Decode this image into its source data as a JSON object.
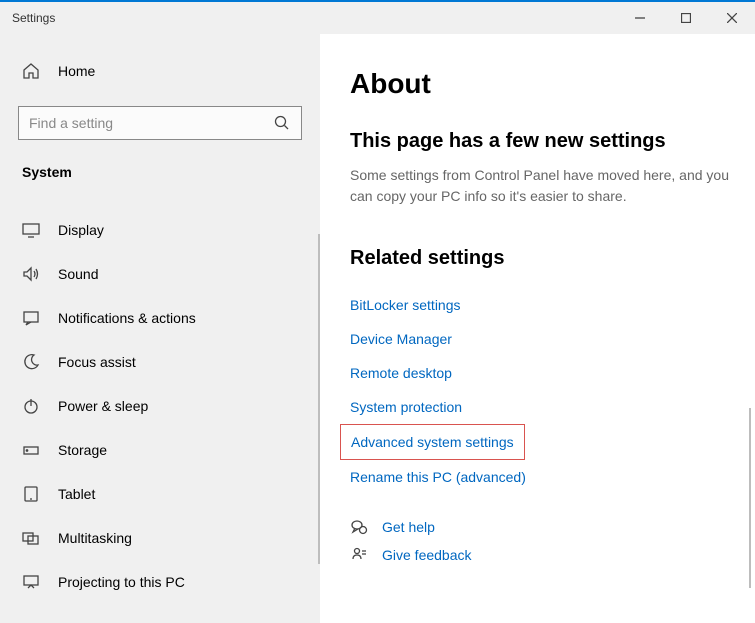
{
  "titlebar": {
    "title": "Settings"
  },
  "sidebar": {
    "home": "Home",
    "search_placeholder": "Find a setting",
    "section": "System",
    "items": [
      {
        "label": "Display"
      },
      {
        "label": "Sound"
      },
      {
        "label": "Notifications & actions"
      },
      {
        "label": "Focus assist"
      },
      {
        "label": "Power & sleep"
      },
      {
        "label": "Storage"
      },
      {
        "label": "Tablet"
      },
      {
        "label": "Multitasking"
      },
      {
        "label": "Projecting to this PC"
      }
    ]
  },
  "main": {
    "title": "About",
    "subhead": "This page has a few new settings",
    "subtext": "Some settings from Control Panel have moved here, and you can copy your PC info so it's easier to share.",
    "related_head": "Related settings",
    "related_links": [
      {
        "label": "BitLocker settings"
      },
      {
        "label": "Device Manager"
      },
      {
        "label": "Remote desktop"
      },
      {
        "label": "System protection"
      },
      {
        "label": "Advanced system settings",
        "highlighted": true
      },
      {
        "label": "Rename this PC (advanced)"
      }
    ],
    "help": {
      "get_help": "Get help",
      "give_feedback": "Give feedback"
    }
  }
}
